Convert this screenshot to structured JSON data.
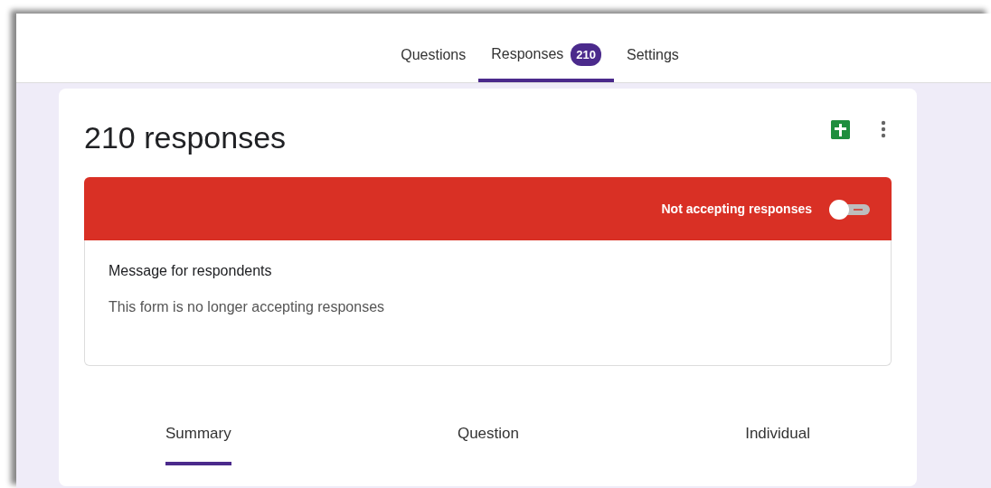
{
  "top_tabs": [
    {
      "label": "Questions",
      "selected": false
    },
    {
      "label": "Responses",
      "selected": true,
      "badge": "210"
    },
    {
      "label": "Settings",
      "selected": false
    }
  ],
  "title": "210 responses",
  "banner": {
    "label": "Not accepting responses",
    "on": false
  },
  "message": {
    "label": "Message for respondents",
    "value": "This form is no longer accepting responses"
  },
  "view_tabs": [
    {
      "label": "Summary",
      "selected": true
    },
    {
      "label": "Question",
      "selected": false
    },
    {
      "label": "Individual",
      "selected": false
    }
  ]
}
